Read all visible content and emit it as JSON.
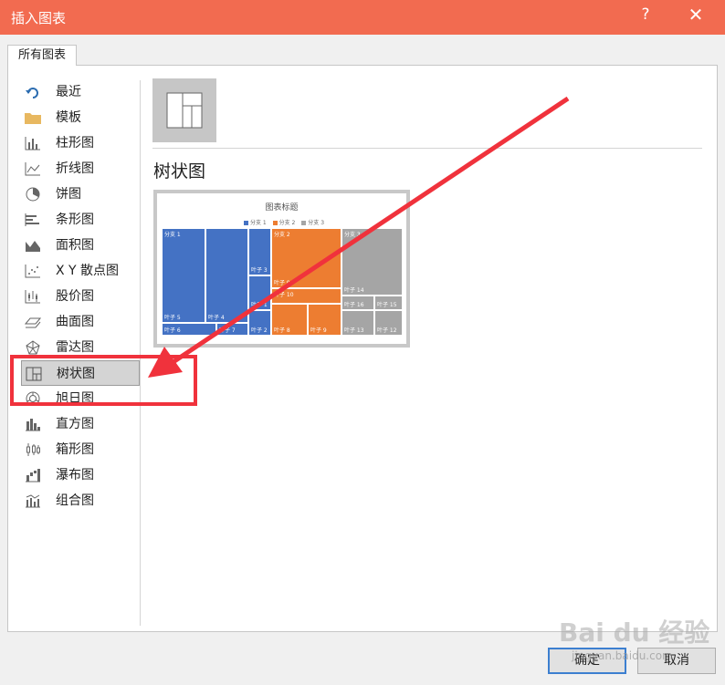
{
  "window": {
    "title": "插入图表",
    "help": "?",
    "close": "✕"
  },
  "tab": {
    "label": "所有图表"
  },
  "sidebar": {
    "items": [
      {
        "label": "最近",
        "icon": "recent-icon"
      },
      {
        "label": "模板",
        "icon": "folder-icon"
      },
      {
        "label": "柱形图",
        "icon": "column-chart-icon"
      },
      {
        "label": "折线图",
        "icon": "line-chart-icon"
      },
      {
        "label": "饼图",
        "icon": "pie-chart-icon"
      },
      {
        "label": "条形图",
        "icon": "bar-chart-icon"
      },
      {
        "label": "面积图",
        "icon": "area-chart-icon"
      },
      {
        "label": "X Y 散点图",
        "icon": "scatter-chart-icon"
      },
      {
        "label": "股价图",
        "icon": "stock-chart-icon"
      },
      {
        "label": "曲面图",
        "icon": "surface-chart-icon"
      },
      {
        "label": "雷达图",
        "icon": "radar-chart-icon"
      },
      {
        "label": "树状图",
        "icon": "treemap-chart-icon",
        "selected": true
      },
      {
        "label": "旭日图",
        "icon": "sunburst-chart-icon"
      },
      {
        "label": "直方图",
        "icon": "histogram-chart-icon"
      },
      {
        "label": "箱形图",
        "icon": "box-whisker-chart-icon"
      },
      {
        "label": "瀑布图",
        "icon": "waterfall-chart-icon"
      },
      {
        "label": "组合图",
        "icon": "combo-chart-icon"
      }
    ]
  },
  "main": {
    "subtype_title": "树状图",
    "preview": {
      "title": "图表标题",
      "legend": [
        "分支 1",
        "分支 2",
        "分支 3"
      ],
      "colors": {
        "branch1": "#4472c4",
        "branch2": "#ed7d31",
        "branch3": "#a5a5a5"
      },
      "cells": [
        {
          "top": "分支 1",
          "bottom": "叶子 5"
        },
        {
          "top": "",
          "bottom": "叶子 4"
        },
        {
          "top": "叶子 3",
          "bottom": ""
        },
        {
          "top": "",
          "bottom": "叶子 1"
        },
        {
          "top": "",
          "bottom": "叶子 2"
        },
        {
          "top": "",
          "bottom": "叶子 6"
        },
        {
          "top": "",
          "bottom": "叶子 7"
        },
        {
          "top": "分支 2",
          "bottom": "叶子 9"
        },
        {
          "top": "叶子 10",
          "bottom": ""
        },
        {
          "top": "",
          "bottom": "叶子 8"
        },
        {
          "top": "",
          "bottom": "叶子 9"
        },
        {
          "top": "分支 3",
          "bottom": "叶子 14"
        },
        {
          "top": "叶子 16",
          "bottom": ""
        },
        {
          "top": "叶子 15",
          "bottom": ""
        },
        {
          "top": "",
          "bottom": "叶子 13"
        },
        {
          "top": "",
          "bottom": "叶子 12"
        }
      ]
    }
  },
  "buttons": {
    "ok": "确定",
    "cancel": "取消"
  },
  "watermark": {
    "brand": "Bai du 经验",
    "url": "jingyan.baidu.com"
  }
}
